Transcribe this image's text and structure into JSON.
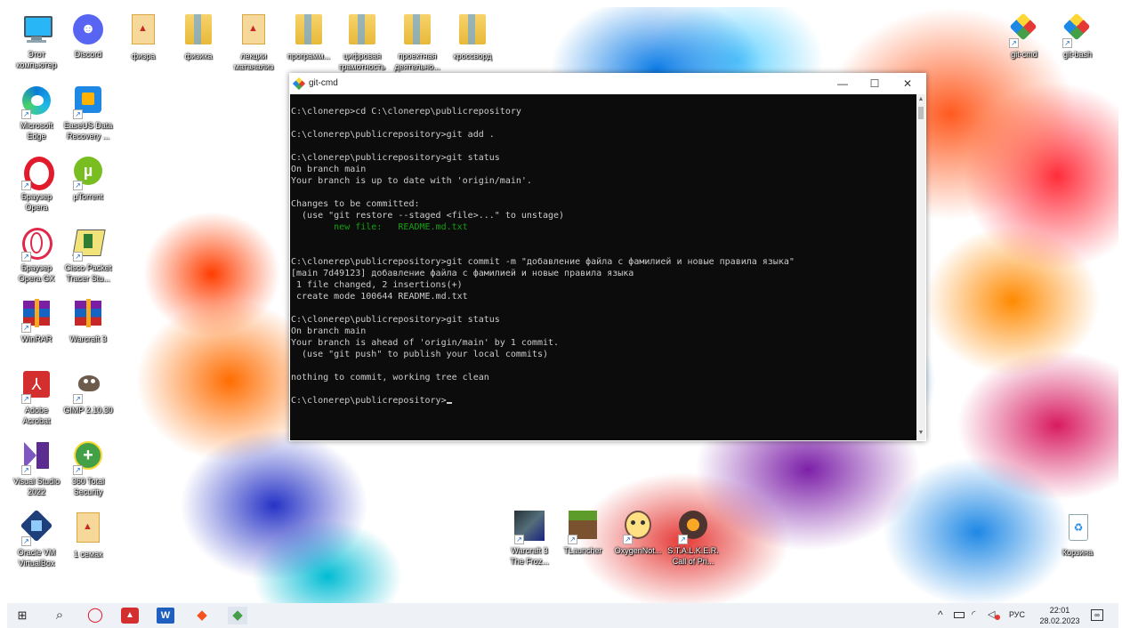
{
  "desktop": {
    "icons": [
      {
        "name": "this-pc",
        "label": "Этот\nкомпьютер",
        "icon": "monitor-icon"
      },
      {
        "name": "discord",
        "label": "Discord",
        "icon": "discord-icon"
      },
      {
        "name": "fizra",
        "label": "физра",
        "icon": "pdf-icon"
      },
      {
        "name": "fizika",
        "label": "физика",
        "icon": "folder-icon"
      },
      {
        "name": "lekcii",
        "label": "лекции\nматанализ",
        "icon": "pdf-icon"
      },
      {
        "name": "programm",
        "label": "программ...",
        "icon": "folder-icon"
      },
      {
        "name": "cifrovaya",
        "label": "цифровая\nграмотность",
        "icon": "folder-icon"
      },
      {
        "name": "proektnaya",
        "label": "проектная\nдеятельно...",
        "icon": "folder-icon"
      },
      {
        "name": "krossvord",
        "label": "кроссворд",
        "icon": "folder-icon"
      },
      {
        "name": "edge",
        "label": "Microsoft\nEdge",
        "icon": "edge-icon"
      },
      {
        "name": "easeus",
        "label": "EaseUS Data\nRecovery ...",
        "icon": "easeus-icon"
      },
      {
        "name": "opera",
        "label": "Браузер\nOpera",
        "icon": "opera-icon"
      },
      {
        "name": "utorrent",
        "label": "µTorrent",
        "icon": "utorrent-icon"
      },
      {
        "name": "opera-gx",
        "label": "Браузер\nOpera GX",
        "icon": "opera-gx-icon"
      },
      {
        "name": "cisco",
        "label": "Cisco Packet\nTracer Stu...",
        "icon": "cisco-icon"
      },
      {
        "name": "winrar",
        "label": "WinRAR",
        "icon": "winrar-icon"
      },
      {
        "name": "warcraft3-rar",
        "label": "Warcraft 3",
        "icon": "winrar-icon"
      },
      {
        "name": "acrobat",
        "label": "Adobe\nAcrobat",
        "icon": "acrobat-icon"
      },
      {
        "name": "gimp",
        "label": "GIMP 2.10.30",
        "icon": "gimp-icon"
      },
      {
        "name": "vs2022",
        "label": "Visual Studio\n2022",
        "icon": "visual-studio-icon"
      },
      {
        "name": "360",
        "label": "360 Total\nSecurity",
        "icon": "360-security-icon"
      },
      {
        "name": "virtualbox",
        "label": "Oracle VM\nVirtualBox",
        "icon": "virtualbox-icon"
      },
      {
        "name": "1-semak",
        "label": "1 семак",
        "icon": "pdf-icon"
      },
      {
        "name": "warcraft3-game",
        "label": "Warcraft 3\nThe Froz...",
        "icon": "warcraft-icon"
      },
      {
        "name": "tlauncher",
        "label": "TLauncher",
        "icon": "tlauncher-icon"
      },
      {
        "name": "oxygen",
        "label": "OxygenNot...",
        "icon": "oxygen-icon"
      },
      {
        "name": "stalker",
        "label": "S.T.A.L.K.E.R.\nCall of Pri...",
        "icon": "stalker-icon"
      },
      {
        "name": "git-cmd",
        "label": "git-cmd",
        "icon": "git-icon"
      },
      {
        "name": "git-bash",
        "label": "git-bash",
        "icon": "git-icon"
      },
      {
        "name": "recycle-bin",
        "label": "Корзина",
        "icon": "recycle-bin-icon"
      }
    ]
  },
  "window": {
    "title": "git-cmd",
    "controls": {
      "minimize": "—",
      "maximize": "☐",
      "close": "✕"
    }
  },
  "terminal": {
    "lines": [
      {
        "text": "C:\\clonerep>cd C:\\clonerep\\publicrepository",
        "color": "default"
      },
      {
        "text": "",
        "color": "default"
      },
      {
        "text": "C:\\clonerep\\publicrepository>git add .",
        "color": "default"
      },
      {
        "text": "",
        "color": "default"
      },
      {
        "text": "C:\\clonerep\\publicrepository>git status",
        "color": "default"
      },
      {
        "text": "On branch main",
        "color": "default"
      },
      {
        "text": "Your branch is up to date with 'origin/main'.",
        "color": "default"
      },
      {
        "text": "",
        "color": "default"
      },
      {
        "text": "Changes to be committed:",
        "color": "default"
      },
      {
        "text": "  (use \"git restore --staged <file>...\" to unstage)",
        "color": "default"
      },
      {
        "text": "        new file:   README.md.txt",
        "color": "green"
      },
      {
        "text": "",
        "color": "default"
      },
      {
        "text": "",
        "color": "default"
      },
      {
        "text": "C:\\clonerep\\publicrepository>git commit -m \"добавление файла с фамилией и новые правила языка\"",
        "color": "default"
      },
      {
        "text": "[main 7d49123] добавление файла с фамилией и новые правила языка",
        "color": "default"
      },
      {
        "text": " 1 file changed, 2 insertions(+)",
        "color": "default"
      },
      {
        "text": " create mode 100644 README.md.txt",
        "color": "default"
      },
      {
        "text": "",
        "color": "default"
      },
      {
        "text": "C:\\clonerep\\publicrepository>git status",
        "color": "default"
      },
      {
        "text": "On branch main",
        "color": "default"
      },
      {
        "text": "Your branch is ahead of 'origin/main' by 1 commit.",
        "color": "default"
      },
      {
        "text": "  (use \"git push\" to publish your local commits)",
        "color": "default"
      },
      {
        "text": "",
        "color": "default"
      },
      {
        "text": "nothing to commit, working tree clean",
        "color": "default"
      },
      {
        "text": "",
        "color": "default"
      },
      {
        "text": "C:\\clonerep\\publicrepository>",
        "color": "default",
        "cursor": true
      }
    ]
  },
  "taskbar": {
    "apps": [
      {
        "name": "start",
        "icon": "windows-start-icon",
        "glyph": "⊞"
      },
      {
        "name": "search",
        "icon": "search-icon",
        "glyph": "⌕"
      },
      {
        "name": "opera",
        "icon": "opera-icon",
        "glyph": "◯"
      },
      {
        "name": "acrobat",
        "icon": "acrobat-icon",
        "glyph": "▲"
      },
      {
        "name": "word",
        "icon": "word-icon",
        "glyph": "W"
      },
      {
        "name": "git",
        "icon": "git-icon",
        "glyph": "◆"
      },
      {
        "name": "git-active",
        "icon": "git-icon",
        "glyph": "◆"
      }
    ],
    "tray": {
      "language": "РУС",
      "time": "22:01",
      "date": "28.02.2023"
    }
  },
  "colors": {
    "terminal_bg": "#0c0c0c",
    "terminal_fg": "#cccccc",
    "terminal_green": "#13a10e",
    "taskbar_bg": "#eef1f6"
  }
}
